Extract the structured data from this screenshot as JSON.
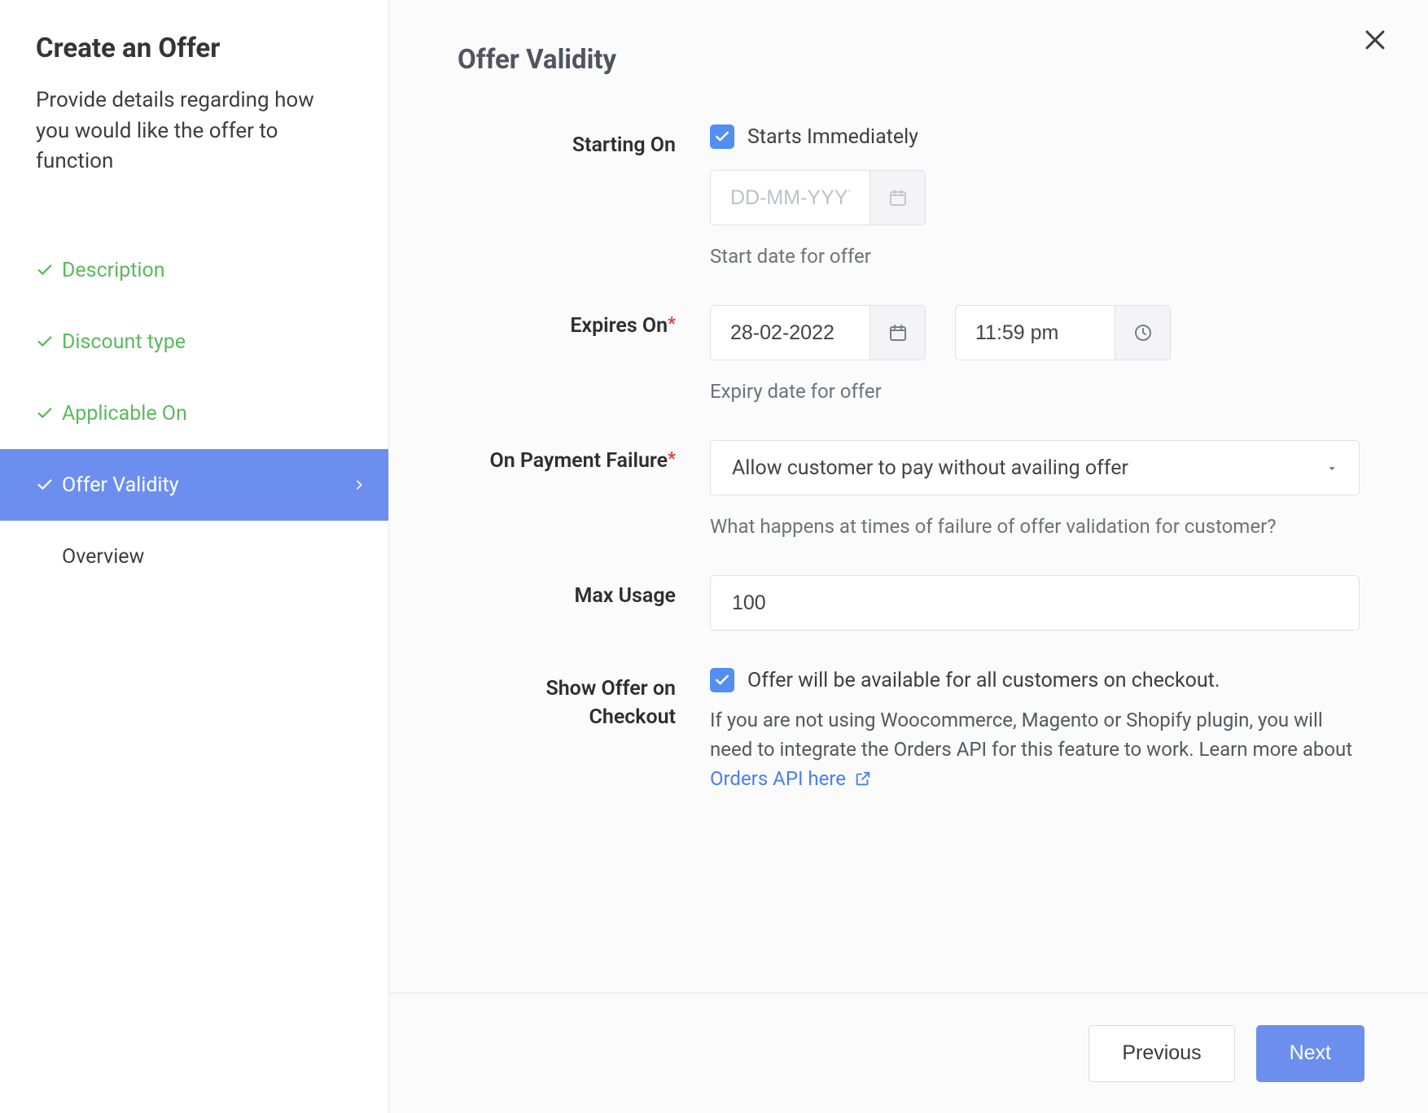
{
  "sidebar": {
    "title": "Create an Offer",
    "description": "Provide details regarding how you would like the offer to function",
    "items": [
      {
        "label": "Description"
      },
      {
        "label": "Discount type"
      },
      {
        "label": "Applicable On"
      },
      {
        "label": "Offer Validity"
      },
      {
        "label": "Overview"
      }
    ]
  },
  "main": {
    "title": "Offer Validity"
  },
  "form": {
    "starting_on": {
      "label": "Starting On",
      "checkbox_label": "Starts Immediately",
      "date_placeholder": "DD-MM-YYYY",
      "help": "Start date for offer"
    },
    "expires_on": {
      "label": "Expires On",
      "date_value": "28-02-2022",
      "time_value": "11:59 pm",
      "help": "Expiry date for offer"
    },
    "payment_failure": {
      "label": "On Payment Failure",
      "selected": "Allow customer to pay without availing offer",
      "help": "What happens at times of failure of offer validation for customer?"
    },
    "max_usage": {
      "label": "Max Usage",
      "value": "100"
    },
    "show_on_checkout": {
      "label": "Show Offer on Checkout",
      "checkbox_label": "Offer will be available for all customers on checkout.",
      "info_prefix": "If you are not using Woocommerce, Magento or Shopify plugin, you will need to integrate the Orders API for this feature to work. Learn more about  ",
      "link_text": "Orders API here"
    }
  },
  "footer": {
    "previous": "Previous",
    "next": "Next"
  }
}
